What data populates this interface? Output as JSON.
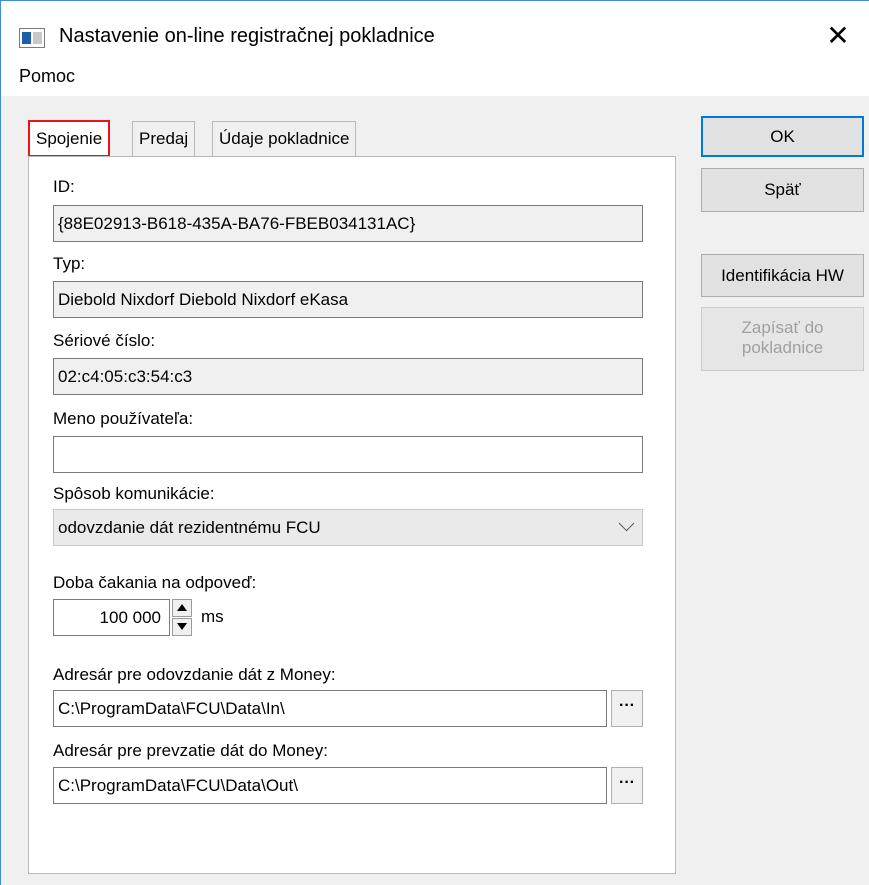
{
  "window": {
    "title": "Nastavenie on-line registračnej pokladnice",
    "close_glyph": "✕"
  },
  "menu": {
    "help": "Pomoc"
  },
  "tabs": [
    {
      "label": "Spojenie",
      "active": true
    },
    {
      "label": "Predaj",
      "active": false
    },
    {
      "label": "Údaje pokladnice",
      "active": false
    }
  ],
  "form": {
    "id_label": "ID:",
    "id_value": "{88E02913-B618-435A-BA76-FBEB034131AC}",
    "type_label": "Typ:",
    "type_value": "Diebold Nixdorf Diebold Nixdorf eKasa",
    "serial_label": "Sériové číslo:",
    "serial_value": "02:c4:05:c3:54:c3",
    "username_label": "Meno používateľa:",
    "username_value": "",
    "comm_label": "Spôsob komunikácie:",
    "comm_value": "odovzdanie dát rezidentnému FCU",
    "timeout_label": "Doba čakania na odpoveď:",
    "timeout_value": "100 000",
    "timeout_unit": "ms",
    "out_dir_label": "Adresár pre odovzdanie dát z Money:",
    "out_dir_value": "C:\\ProgramData\\FCU\\Data\\In\\",
    "in_dir_label": "Adresár pre prevzatie dát do Money:",
    "in_dir_value": "C:\\ProgramData\\FCU\\Data\\Out\\",
    "browse_label": "···"
  },
  "buttons": {
    "ok": "OK",
    "back": "Späť",
    "identify_hw": "Identifikácia HW",
    "write_line1": "Zapísať do",
    "write_line2": "pokladnice"
  },
  "colors": {
    "accent": "#0078d7",
    "highlight": "#e8141c"
  }
}
